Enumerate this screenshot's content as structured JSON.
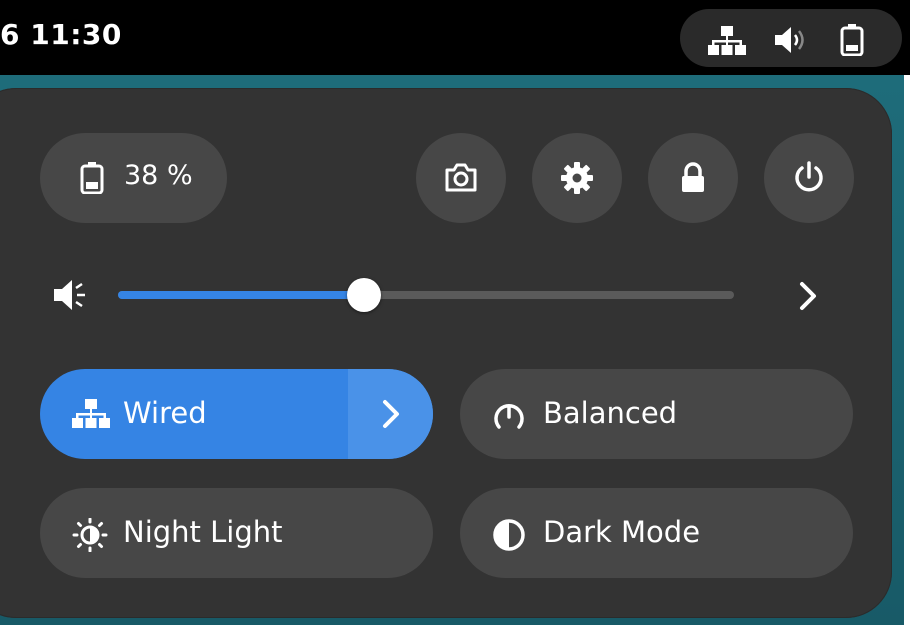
{
  "topbar": {
    "clock": "6  11:30",
    "status_icons": [
      "network-wired-icon",
      "volume-icon",
      "battery-icon"
    ]
  },
  "quick_settings": {
    "battery": {
      "icon": "battery-icon",
      "label": "38 %",
      "level": 0.38
    },
    "system_buttons": [
      {
        "name": "screenshot-button",
        "icon": "camera-icon"
      },
      {
        "name": "settings-button",
        "icon": "gear-icon"
      },
      {
        "name": "lock-button",
        "icon": "lock-icon"
      },
      {
        "name": "power-button",
        "icon": "power-icon"
      }
    ],
    "volume": {
      "icon": "speaker-icon",
      "level": 0.4,
      "menu_arrow": "chevron-right-icon"
    },
    "toggles": [
      {
        "label": "Wired",
        "icon": "network-wired-icon",
        "active": true,
        "has_menu": true
      },
      {
        "label": "Balanced",
        "icon": "power-profile-icon",
        "active": false
      },
      {
        "label": "Night Light",
        "icon": "night-light-icon",
        "active": false
      },
      {
        "label": "Dark Mode",
        "icon": "dark-mode-icon",
        "active": false
      }
    ]
  },
  "colors": {
    "panel": "#333333",
    "button": "#474747",
    "accent": "#3584e4",
    "topbar": "#000000",
    "desktop": "#1b5f6e"
  }
}
